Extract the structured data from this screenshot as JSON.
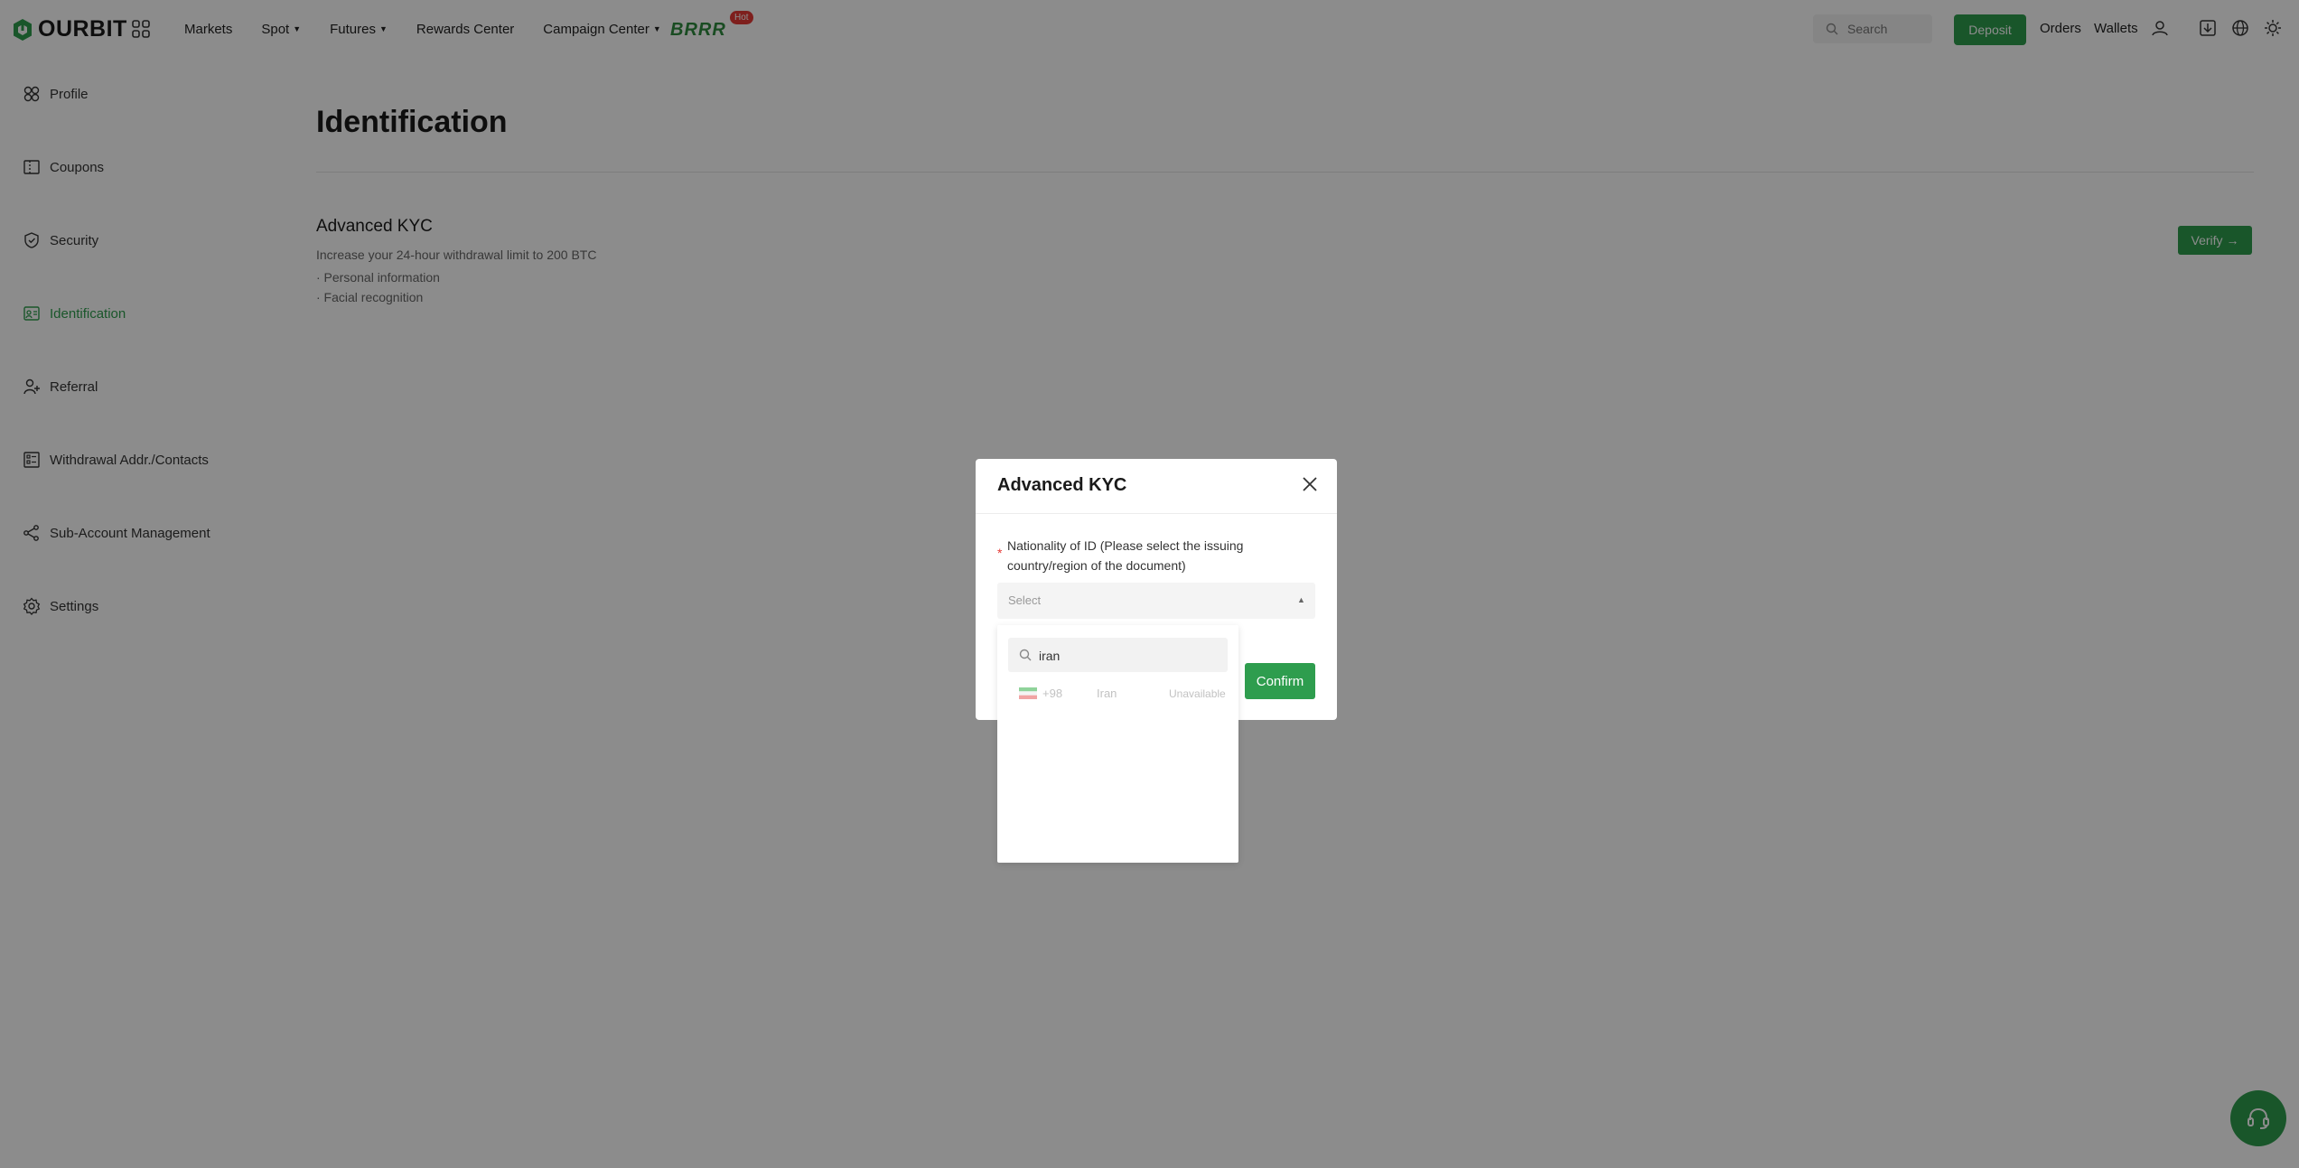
{
  "brand": {
    "name": "OURBIT",
    "accent": "#2e9d4e"
  },
  "nav": {
    "items": [
      {
        "label": "Markets",
        "has_caret": false
      },
      {
        "label": "Spot",
        "has_caret": true
      },
      {
        "label": "Futures",
        "has_caret": true
      },
      {
        "label": "Rewards Center",
        "has_caret": false
      },
      {
        "label": "Campaign Center",
        "has_caret": true
      }
    ],
    "promo_text": "BRRR",
    "hot_badge": "Hot"
  },
  "header": {
    "search_placeholder": "Search",
    "deposit_label": "Deposit",
    "orders_label": "Orders",
    "wallets_label": "Wallets"
  },
  "sidebar": {
    "items": [
      {
        "label": "Profile",
        "icon": "profile-icon",
        "active": false
      },
      {
        "label": "Coupons",
        "icon": "coupon-icon",
        "active": false
      },
      {
        "label": "Security",
        "icon": "shield-icon",
        "active": false
      },
      {
        "label": "Identification",
        "icon": "id-card-icon",
        "active": true
      },
      {
        "label": "Referral",
        "icon": "user-add-icon",
        "active": false
      },
      {
        "label": "Withdrawal Addr./Contacts",
        "icon": "address-book-icon",
        "active": false
      },
      {
        "label": "Sub-Account Management",
        "icon": "share-nodes-icon",
        "active": false
      },
      {
        "label": "Settings",
        "icon": "gear-icon",
        "active": false
      }
    ]
  },
  "main": {
    "title": "Identification",
    "kyc_title": "Advanced KYC",
    "kyc_desc": "Increase your 24-hour withdrawal limit to 200 BTC",
    "kyc_bullets": [
      "· Personal information",
      "· Facial recognition"
    ],
    "verify_label": "Verify →"
  },
  "modal": {
    "title": "Advanced KYC",
    "required_mark": "*",
    "field_label": "Nationality of ID (Please select the issuing country/region of the document)",
    "select_placeholder": "Select",
    "confirm_label": "Confirm"
  },
  "dropdown": {
    "search_value": "iran",
    "options": [
      {
        "code": "+98",
        "name": "Iran",
        "status": "Unavailable",
        "flag": "iran-flag"
      }
    ]
  }
}
